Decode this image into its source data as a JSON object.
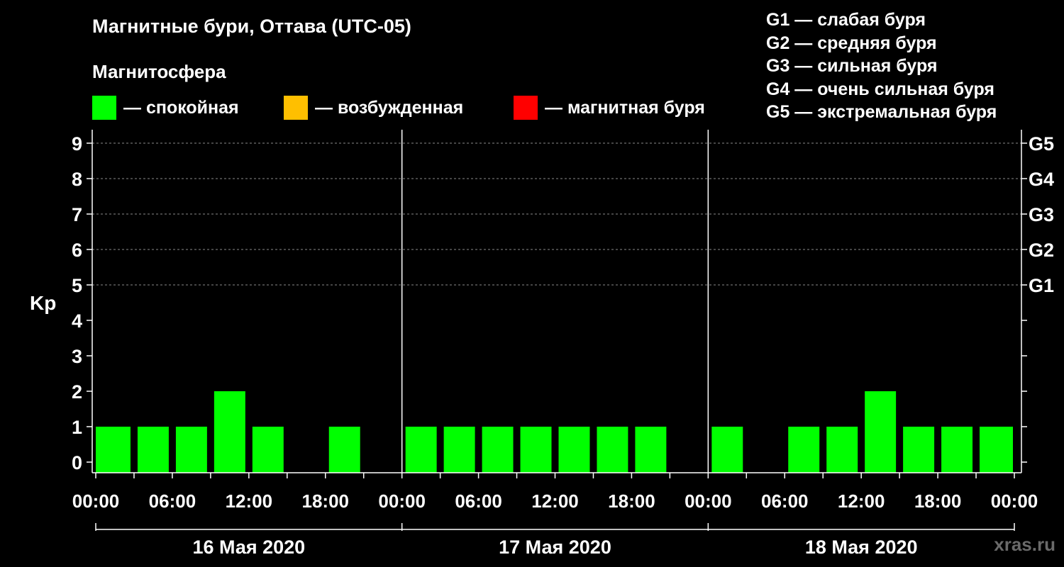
{
  "chart_data": {
    "type": "bar",
    "title": "Магнитные бури, Оттава (UTC-05)",
    "subtitle": "Магнитосфера",
    "ylabel": "Kp",
    "ylim": [
      0,
      9
    ],
    "yticks": [
      "0",
      "1",
      "2",
      "3",
      "4",
      "5",
      "6",
      "7",
      "8",
      "9"
    ],
    "g_levels": [
      {
        "kp": 5,
        "label": "G1"
      },
      {
        "kp": 6,
        "label": "G2"
      },
      {
        "kp": 7,
        "label": "G3"
      },
      {
        "kp": 8,
        "label": "G4"
      },
      {
        "kp": 9,
        "label": "G5"
      }
    ],
    "legend": [
      {
        "label": "— спокойная",
        "color": "#00ff00"
      },
      {
        "label": "— возбужденная",
        "color": "#ffbf00"
      },
      {
        "label": "— магнитная буря",
        "color": "#ff0000"
      }
    ],
    "g_scale": [
      "G1 — слабая буря",
      "G2 — средняя буря",
      "G3 — сильная буря",
      "G4 — очень сильная буря",
      "G5 — экстремальная буря"
    ],
    "x_tick_labels": [
      "00:00",
      "06:00",
      "12:00",
      "18:00",
      "00:00",
      "06:00",
      "12:00",
      "18:00",
      "00:00",
      "06:00",
      "12:00",
      "18:00",
      "00:00"
    ],
    "days": [
      "16 Мая 2020",
      "17 Мая 2020",
      "18 Мая 2020"
    ],
    "interval_hours": 3,
    "start_hour": 0,
    "values": [
      1,
      1,
      1,
      2,
      1,
      0,
      1,
      0,
      1,
      1,
      1,
      1,
      1,
      1,
      1,
      0,
      1,
      0,
      1,
      1,
      2,
      1,
      1,
      1
    ],
    "colors": {
      "quiet": "#00ff00",
      "active": "#ffbf00",
      "storm": "#ff0000"
    }
  },
  "watermark": "xras.ru"
}
